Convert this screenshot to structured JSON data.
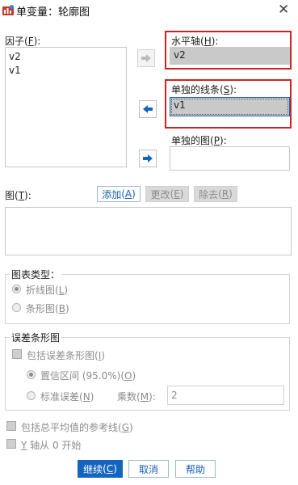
{
  "window": {
    "title": "单变量：轮廓图"
  },
  "factors": {
    "label": "因子",
    "mnemonic": "F",
    "items": [
      "v2",
      "v1"
    ]
  },
  "horizontal_axis": {
    "label": "水平轴",
    "mnemonic": "H",
    "value": "v2"
  },
  "separate_lines": {
    "label": "单独的线条",
    "mnemonic": "S",
    "value": "v1"
  },
  "separate_plots": {
    "label": "单独的图",
    "mnemonic": "P",
    "value": ""
  },
  "plots": {
    "label": "图",
    "mnemonic": "T",
    "add": "添加",
    "add_m": "A",
    "change": "更改",
    "change_m": "E",
    "remove": "除去",
    "remove_m": "R"
  },
  "chart_type": {
    "title": "图表类型：",
    "line": "折线图",
    "line_m": "L",
    "bar": "条形图",
    "bar_m": "B"
  },
  "error_bars": {
    "title": "误差条形图",
    "include": "包括误差条形图",
    "include_m": "I",
    "ci": "置信区间 (95.0%)",
    "ci_m": "O",
    "se": "标准误差",
    "se_m": "N",
    "multiplier_label": "乘数",
    "multiplier_m": "M",
    "multiplier_value": "2"
  },
  "options": {
    "grand_mean": "包括总平均值的参考线",
    "grand_mean_m": "G",
    "y_axis_zero_prefix": "Y",
    "y_axis_zero_rest": " 轴从 0 开始"
  },
  "buttons": {
    "continue": "继续",
    "continue_m": "C",
    "cancel": "取消",
    "help": "帮助"
  },
  "colors": {
    "accent": "#1565c0",
    "highlight_border": "#d42020"
  }
}
